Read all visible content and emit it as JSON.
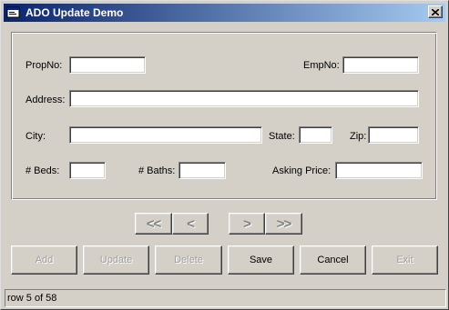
{
  "window": {
    "title": "ADO Update Demo",
    "icons": {
      "app": "app-window-icon",
      "close": "close-x-icon"
    },
    "colors": {
      "title_start": "#0a246a",
      "title_end": "#a6caf0",
      "face": "#d4d0c8"
    }
  },
  "form": {
    "propno_label": "PropNo:",
    "propno_value": "",
    "empno_label": "EmpNo:",
    "empno_value": "",
    "address_label": "Address:",
    "address_value": "",
    "city_label": "City:",
    "city_value": "",
    "state_label": "State:",
    "state_value": "",
    "zip_label": "Zip:",
    "zip_value": "",
    "beds_label": "# Beds:",
    "beds_value": "",
    "baths_label": "# Baths:",
    "baths_value": "",
    "price_label": "Asking Price:",
    "price_value": ""
  },
  "nav": {
    "first_label": "<<",
    "prev_label": "<",
    "next_label": ">",
    "last_label": ">>"
  },
  "actions": {
    "add_label": "Add",
    "update_label": "Update",
    "delete_label": "Delete",
    "save_label": "Save",
    "cancel_label": "Cancel",
    "exit_label": "Exit"
  },
  "status": {
    "text": "row 5 of 58"
  }
}
